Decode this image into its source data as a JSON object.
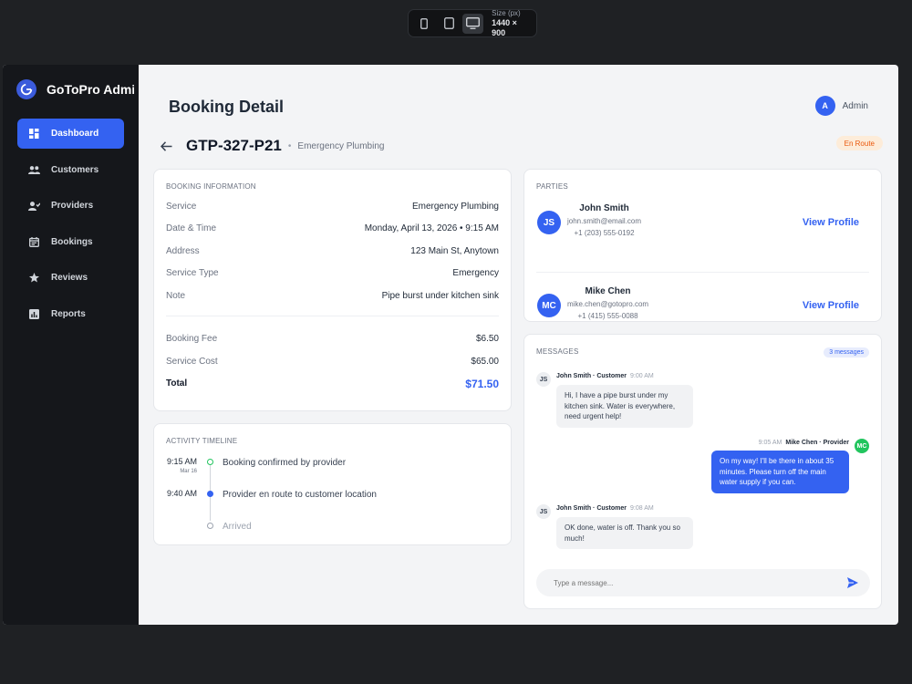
{
  "device_toolbar": {
    "size_label": "Size (px)",
    "size_value": "1440 × 900",
    "devices": [
      "mobile-icon",
      "tablet-icon",
      "desktop-icon"
    ],
    "active": "desktop"
  },
  "sidebar": {
    "brand": "GoToPro Admi",
    "items": [
      {
        "label": "Dashboard",
        "icon": "grid-icon",
        "active": true
      },
      {
        "label": "Customers",
        "icon": "users-icon"
      },
      {
        "label": "Providers",
        "icon": "user-check-icon"
      },
      {
        "label": "Bookings",
        "icon": "calendar-icon"
      },
      {
        "label": "Reviews",
        "icon": "star-icon"
      },
      {
        "label": "Reports",
        "icon": "chart-icon"
      }
    ]
  },
  "header": {
    "title": "Booking Detail",
    "user_initial": "A",
    "user_label": "Admin"
  },
  "booking": {
    "id": "GTP-327-P21",
    "category": "Emergency Plumbing",
    "status": "En Route"
  },
  "booking_info": {
    "title": "Booking Information",
    "rows": [
      {
        "k": "Service",
        "v": "Emergency Plumbing"
      },
      {
        "k": "Date & Time",
        "v": "Monday, April 13, 2026 • 9:15 AM"
      },
      {
        "k": "Address",
        "v": "123 Main St, Anytown"
      },
      {
        "k": "Service Type",
        "v": "Emergency"
      },
      {
        "k": "Note",
        "v": "Pipe burst under kitchen sink"
      }
    ],
    "fees": [
      {
        "k": "Booking Fee",
        "v": "$6.50"
      },
      {
        "k": "Service Cost",
        "v": "$65.00"
      }
    ],
    "total": {
      "k": "Total",
      "v": "$71.50"
    }
  },
  "activity": {
    "title": "Activity Timeline",
    "items": [
      {
        "time": "9:15 AM",
        "date": "Mar 16",
        "text": "Booking confirmed by provider",
        "state": "done"
      },
      {
        "time": "9:40 AM",
        "date": "",
        "text": "Provider en route to customer location",
        "state": "current"
      },
      {
        "time": "",
        "date": "",
        "text": "Arrived",
        "state": "pending"
      }
    ]
  },
  "parties": {
    "title": "Parties",
    "list": [
      {
        "initials": "JS",
        "name": "John Smith",
        "email": "john.smith@email.com",
        "phone": "+1 (203) 555-0192",
        "link": "View Profile"
      },
      {
        "initials": "MC",
        "name": "Mike Chen",
        "email": "mike.chen@gotopro.com",
        "phone": "+1 (415) 555-0088",
        "link": "View Profile"
      }
    ]
  },
  "messages": {
    "title": "Messages",
    "count_label": "3 messages",
    "items": [
      {
        "initials": "JS",
        "sender": "John Smith · Customer",
        "time": "9:00 AM",
        "text": "Hi, I have a pipe burst under my kitchen sink. Water is everywhere, need urgent help!",
        "dir": "in"
      },
      {
        "initials": "MC",
        "sender": "Mike Chen · Provider",
        "time": "9:05 AM",
        "text": "On my way! I'll be there in about 35 minutes. Please turn off the main water supply if you can.",
        "dir": "out"
      },
      {
        "initials": "JS",
        "sender": "John Smith · Customer",
        "time": "9:08 AM",
        "text": "OK done, water is off. Thank you so much!",
        "dir": "in"
      }
    ],
    "input_placeholder": "Type a message..."
  },
  "colors": {
    "accent": "#3462f1",
    "sidebar_bg": "#15171b",
    "status_bg": "#fdecd9",
    "status_fg": "#ea580c",
    "provider_avatar": "#22c55e"
  }
}
